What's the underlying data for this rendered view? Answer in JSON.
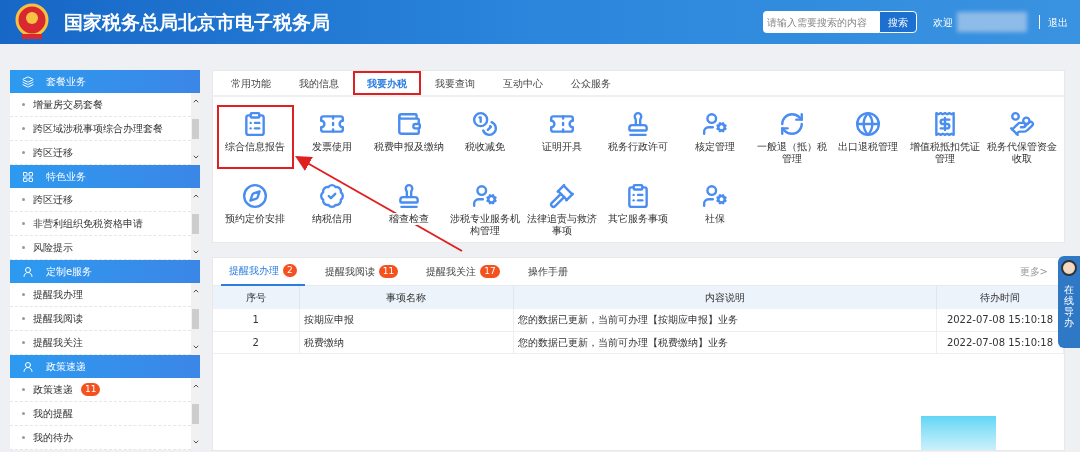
{
  "header": {
    "title": "国家税务总局北京市电子税务局",
    "search": {
      "placeholder": "请输入需要搜索的内容",
      "button": "搜索"
    },
    "welcome": "欢迎",
    "logout": "退出"
  },
  "sidebar": [
    {
      "title": "套餐业务",
      "kind": "stack",
      "items": [
        {
          "label": "增量房交易套餐"
        },
        {
          "label": "跨区域涉税事项综合办理套餐"
        },
        {
          "label": "跨区迁移"
        }
      ]
    },
    {
      "title": "特色业务",
      "kind": "grid",
      "items": [
        {
          "label": "跨区迁移"
        },
        {
          "label": "非营利组织免税资格申请"
        },
        {
          "label": "风险提示"
        }
      ]
    },
    {
      "title": "定制e服务",
      "kind": "user",
      "items": [
        {
          "label": "提醒我办理"
        },
        {
          "label": "提醒我阅读"
        },
        {
          "label": "提醒我关注"
        }
      ]
    },
    {
      "title": "政策速递",
      "kind": "user",
      "items": [
        {
          "label": "政策速递",
          "badge": "11"
        },
        {
          "label": "我的提醒"
        },
        {
          "label": "我的待办"
        }
      ]
    }
  ],
  "main_tabs": [
    {
      "label": "常用功能",
      "selected": false,
      "highlighted": false
    },
    {
      "label": "我的信息",
      "selected": false,
      "highlighted": false
    },
    {
      "label": "我要办税",
      "selected": true,
      "highlighted": true
    },
    {
      "label": "我要查询",
      "selected": false,
      "highlighted": false
    },
    {
      "label": "互动中心",
      "selected": false,
      "highlighted": false
    },
    {
      "label": "公众服务",
      "selected": false,
      "highlighted": false
    }
  ],
  "functions": [
    {
      "label": "综合信息报告",
      "kind": "clipboard",
      "highlighted": true
    },
    {
      "label": "发票使用",
      "kind": "ticket",
      "highlighted": false
    },
    {
      "label": "税费申报及缴纳",
      "kind": "wallet",
      "highlighted": false
    },
    {
      "label": "税收减免",
      "kind": "coin",
      "highlighted": false
    },
    {
      "label": "证明开具",
      "kind": "ticket",
      "highlighted": false
    },
    {
      "label": "税务行政许可",
      "kind": "stamp",
      "highlighted": false
    },
    {
      "label": "核定管理",
      "kind": "person",
      "highlighted": false
    },
    {
      "label": "一般退（抵）税管理",
      "kind": "refresh",
      "highlighted": false
    },
    {
      "label": "出口退税管理",
      "kind": "globe",
      "highlighted": false
    },
    {
      "label": "增值税抵扣凭证管理",
      "kind": "receipt",
      "highlighted": false
    },
    {
      "label": "税务代保管资金收取",
      "kind": "hand",
      "highlighted": false
    },
    {
      "label": "预约定价安排",
      "kind": "compass",
      "highlighted": false
    },
    {
      "label": "纳税信用",
      "kind": "badge",
      "highlighted": false
    },
    {
      "label": "稽查检查",
      "kind": "stamp",
      "highlighted": false
    },
    {
      "label": "涉税专业服务机构管理",
      "kind": "person",
      "highlighted": false
    },
    {
      "label": "法律追责与救济事项",
      "kind": "gavel",
      "highlighted": false
    },
    {
      "label": "其它服务事项",
      "kind": "clipboard",
      "highlighted": false
    },
    {
      "label": "社保",
      "kind": "person",
      "highlighted": false
    }
  ],
  "reminder_tabs": [
    {
      "label": "提醒我办理",
      "count": "2",
      "selected": true
    },
    {
      "label": "提醒我阅读",
      "count": "11",
      "selected": false
    },
    {
      "label": "提醒我关注",
      "count": "17",
      "selected": false
    },
    {
      "label": "操作手册",
      "selected": false
    }
  ],
  "more": "更多>",
  "table": {
    "columns": [
      "序号",
      "事项名称",
      "内容说明",
      "待办时间"
    ],
    "rows": [
      [
        "1",
        "按期应申报",
        "您的数据已更新，当前可办理【按期应申报】业务",
        "2022-07-08 15:10:18"
      ],
      [
        "2",
        "税费缴纳",
        "您的数据已更新，当前可办理【税费缴纳】业务",
        "2022-07-08 15:10:18"
      ]
    ]
  },
  "guide": "在线导办"
}
